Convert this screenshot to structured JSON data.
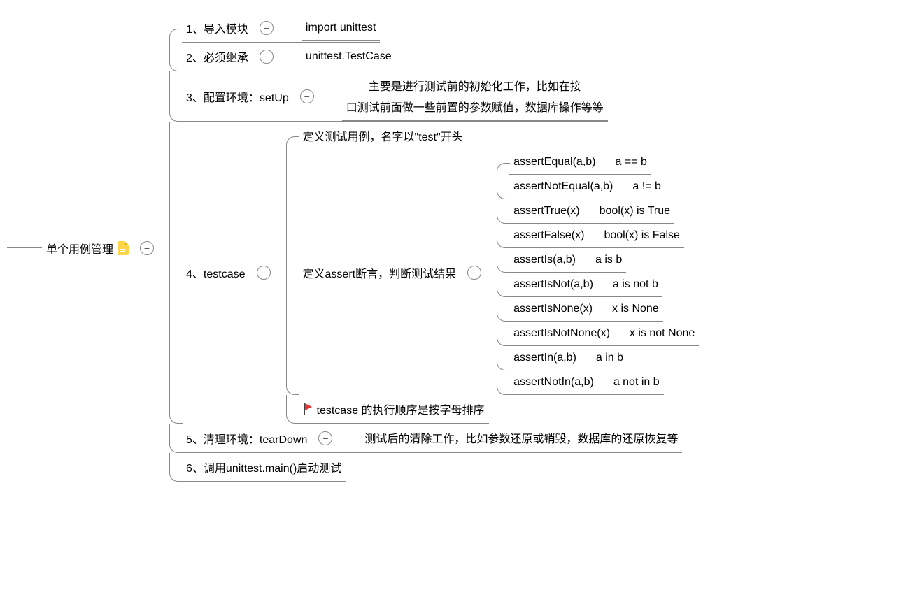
{
  "root": {
    "title": "单个用例管理"
  },
  "n1": {
    "title": "1、导入模块",
    "detail": "import unittest"
  },
  "n2": {
    "title": "2、必须继承",
    "detail": "unittest.TestCase"
  },
  "n3": {
    "title": "3、配置环境：setUp",
    "detail_l1": "主要是进行测试前的初始化工作，比如在接",
    "detail_l2": "口测试前面做一些前置的参数赋值，数据库操作等等"
  },
  "n4": {
    "title": "4、testcase",
    "c1": "定义测试用例，名字以\"test\"开头",
    "c2": "定义assert断言，判断测试结果",
    "c3": "testcase 的执行顺序是按字母排序",
    "asserts": [
      {
        "m": "assertEqual(a,b)",
        "r": "a == b"
      },
      {
        "m": "assertNotEqual(a,b)",
        "r": "a != b"
      },
      {
        "m": "assertTrue(x)",
        "r": "bool(x) is True"
      },
      {
        "m": "assertFalse(x)",
        "r": "bool(x) is False"
      },
      {
        "m": "assertIs(a,b)",
        "r": "a is b"
      },
      {
        "m": "assertIsNot(a,b)",
        "r": "a is not b"
      },
      {
        "m": "assertIsNone(x)",
        "r": "x is None"
      },
      {
        "m": "assertIsNotNone(x)",
        "r": "x is not None"
      },
      {
        "m": "assertIn(a,b)",
        "r": "a in b"
      },
      {
        "m": "assertNotIn(a,b)",
        "r": "a not in b"
      }
    ]
  },
  "n5": {
    "title": "5、清理环境：tearDown",
    "detail": "测试后的清除工作，比如参数还原或销毁，数据库的还原恢复等"
  },
  "n6": {
    "title": "6、调用unittest.main()启动测试"
  },
  "ui": {
    "minus": "−"
  }
}
